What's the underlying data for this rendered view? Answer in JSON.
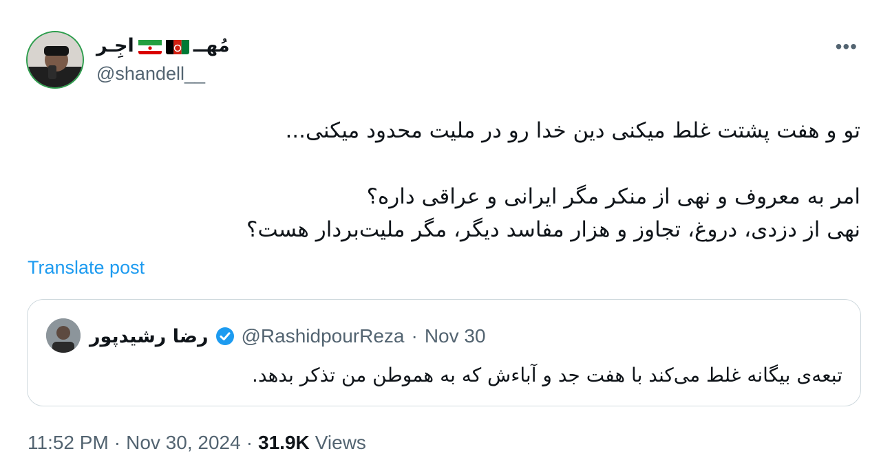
{
  "author": {
    "display_name": "مُهــ",
    "display_name_tail": "اجِـر",
    "handle": "@shandell__",
    "flags": [
      "afghanistan-flag",
      "iran-flag"
    ]
  },
  "menu": {
    "more_label": "•••"
  },
  "tweet": {
    "line1": "تو و هفت پشتت غلط میکنی دین خدا رو در ملیت محدود میکنی...",
    "line2": "امر به معروف و نهی از منکر مگر ایرانی و عراقی داره؟",
    "line3": "نهی از دزدی، دروغ، تجاوز و هزار مفاسد دیگر، مگر ملیت‌بردار هست؟"
  },
  "translate_label": "Translate post",
  "quote": {
    "name": "رضا رشیدپور",
    "handle": "@RashidpourReza",
    "separator": "·",
    "date": "Nov 30",
    "text": "تبعه‌ی بیگانه غلط می‌کند با هفت جد و آباءش که به هموطن من تذکر بدهد."
  },
  "meta": {
    "time": "11:52 PM",
    "sep1": "·",
    "date": "Nov 30, 2024",
    "sep2": "·",
    "views_count": "31.9K",
    "views_label": "Views"
  },
  "colors": {
    "accent": "#1d9bf0",
    "muted": "#536471",
    "text": "#0f1419",
    "border": "#cfd9de"
  }
}
